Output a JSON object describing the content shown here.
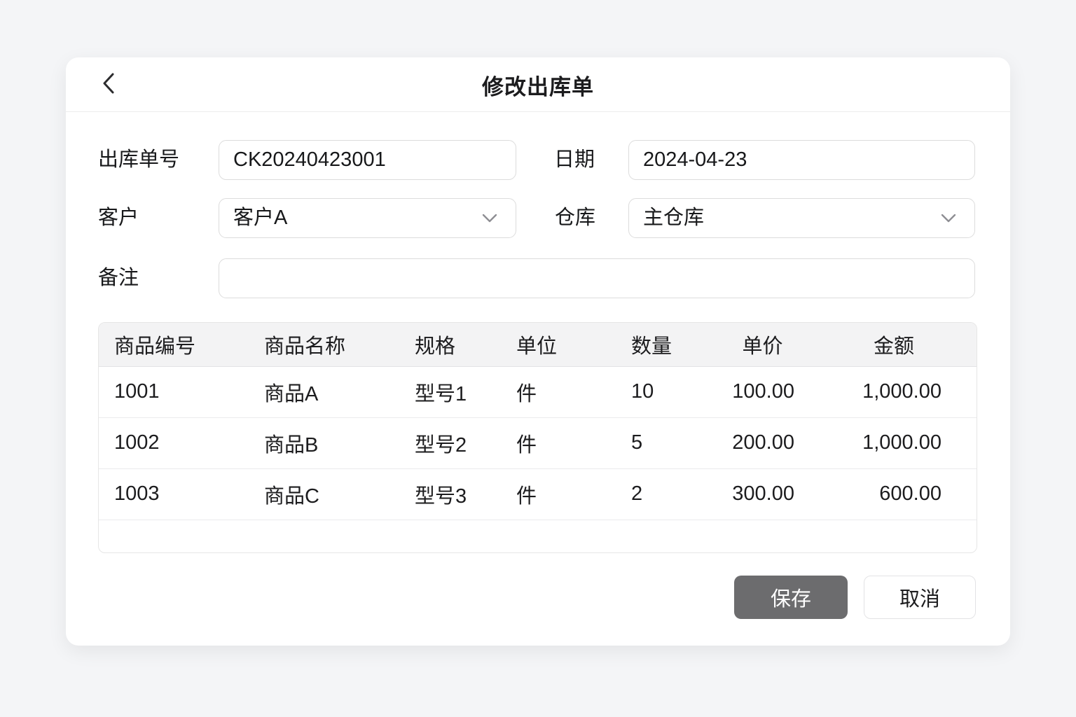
{
  "header": {
    "title": "修改出库单"
  },
  "form": {
    "order_no": {
      "label": "出库单号",
      "value": "CK20240423001"
    },
    "date": {
      "label": "日期",
      "value": "2024-04-23"
    },
    "customer": {
      "label": "客户",
      "value": "客户A"
    },
    "warehouse": {
      "label": "仓库",
      "value": "主仓库"
    },
    "remark": {
      "label": "备注",
      "value": ""
    }
  },
  "table": {
    "columns": [
      "商品编号",
      "商品名称",
      "规格",
      "单位",
      "数量",
      "单价",
      "金额"
    ],
    "rows": [
      [
        "1001",
        "商品A",
        "型号1",
        "件",
        "10",
        "100.00",
        "1,000.00"
      ],
      [
        "1002",
        "商品B",
        "型号2",
        "件",
        "5",
        "200.00",
        "1,000.00"
      ],
      [
        "1003",
        "商品C",
        "型号3",
        "件",
        "2",
        "300.00",
        "600.00"
      ]
    ]
  },
  "buttons": {
    "save": "保存",
    "cancel": "取消"
  },
  "colors": {
    "page_bg": "#f4f5f7",
    "card_bg": "#ffffff",
    "table_header_bg": "#f3f3f4",
    "save_button_bg": "#6c6c6e",
    "save_button_text": "#ffffff",
    "border": "#dcdcdc"
  }
}
